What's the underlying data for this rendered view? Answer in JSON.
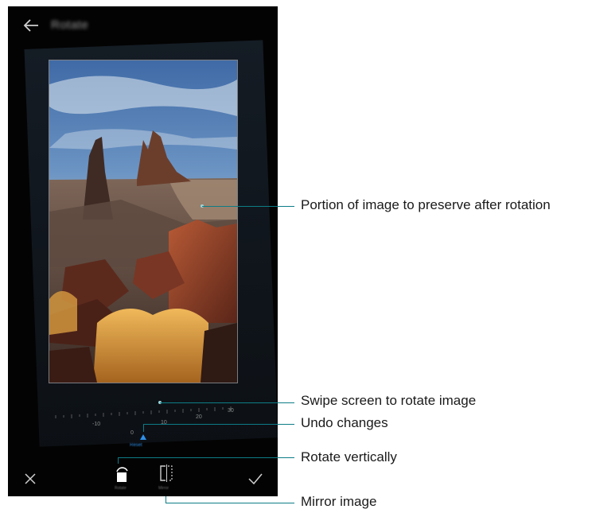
{
  "header": {
    "title": "Rotate"
  },
  "dial": {
    "tick_labels": [
      "-10",
      "0",
      "10",
      "20",
      "30"
    ],
    "reset_label": "Reset"
  },
  "toolbar": {
    "rotate_label": "Rotate",
    "mirror_label": "Mirror"
  },
  "callouts": {
    "preserve": "Portion of image to preserve after rotation",
    "swipe": "Swipe screen to rotate image",
    "undo": "Undo changes",
    "rotate": "Rotate vertically",
    "mirror": "Mirror image"
  },
  "colors": {
    "callout": "#0d7c86",
    "accent": "#2f8fe6"
  }
}
